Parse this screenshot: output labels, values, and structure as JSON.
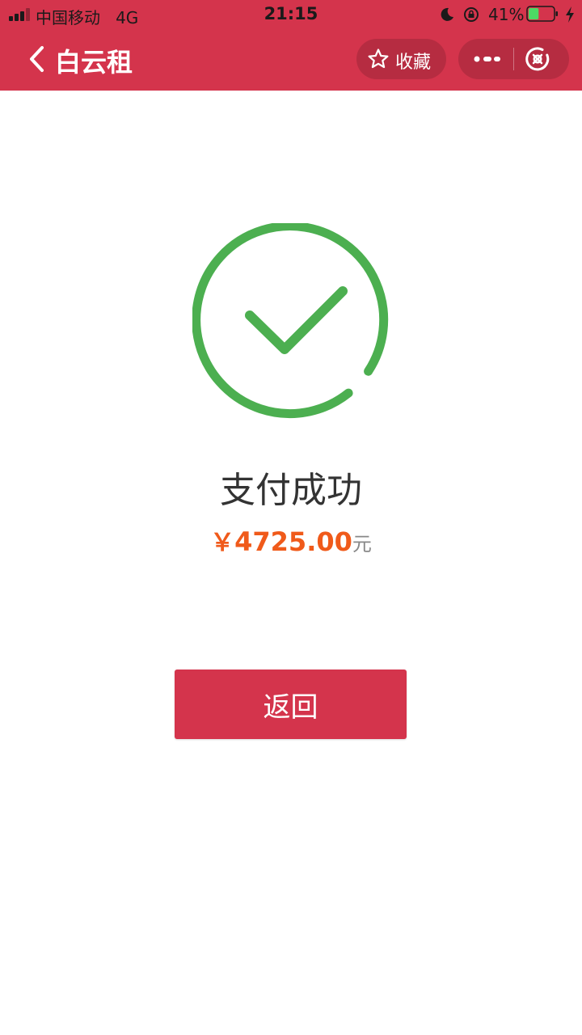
{
  "status_bar": {
    "carrier": "中国移动",
    "network": "4G",
    "time": "21:15",
    "battery": "41%",
    "battery_level": 0.41
  },
  "nav": {
    "title": "白云租",
    "favorite_label": "收藏"
  },
  "result": {
    "status": "支付成功",
    "currency": "￥",
    "amount": "4725.00",
    "unit": "元"
  },
  "actions": {
    "return_label": "返回"
  },
  "colors": {
    "brand": "#d4344c",
    "success": "#4caf50",
    "amount": "#f05a1a"
  },
  "icons": [
    "back-icon",
    "star-icon",
    "more-icon",
    "close-icon",
    "check-circle-icon",
    "moon-icon",
    "orientation-lock-icon",
    "battery-icon",
    "charging-icon"
  ]
}
